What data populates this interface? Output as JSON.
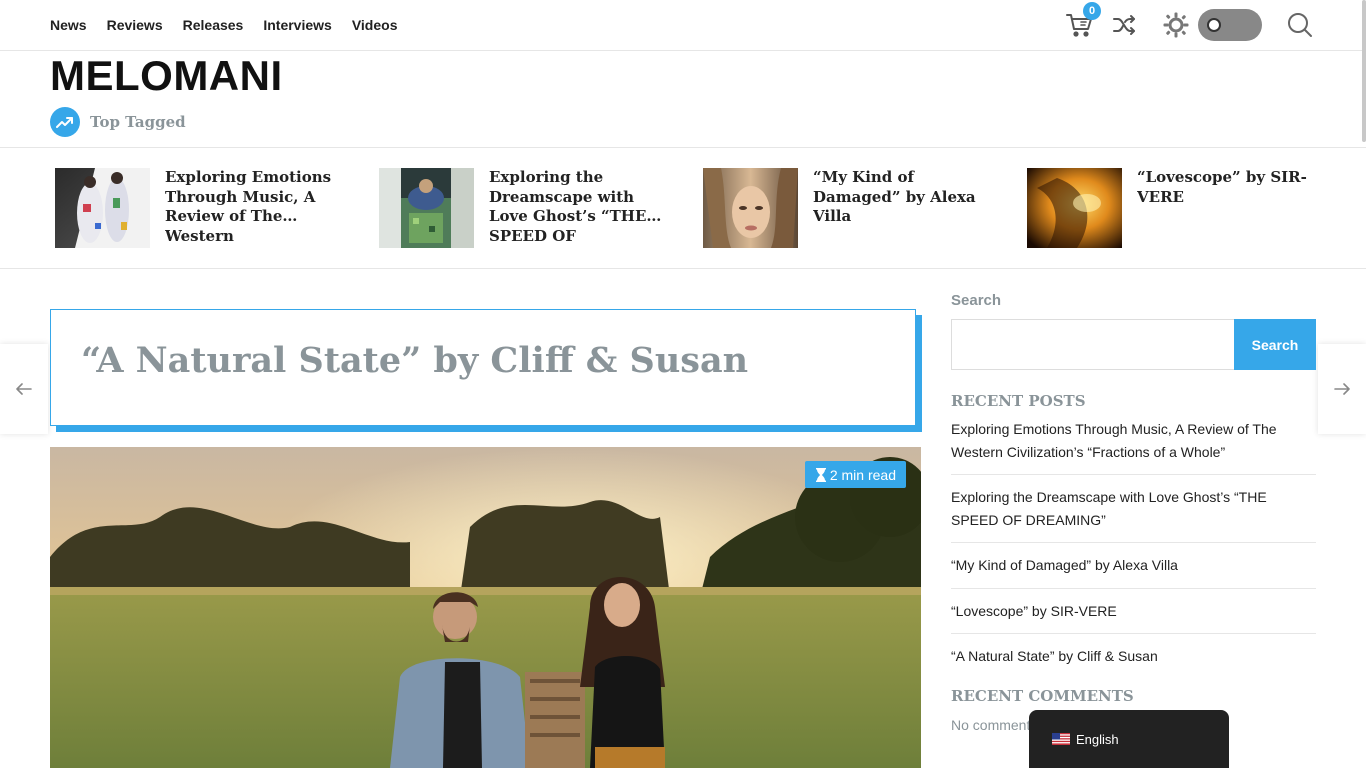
{
  "nav": {
    "items": [
      "News",
      "Reviews",
      "Releases",
      "Interviews",
      "Videos"
    ]
  },
  "header": {
    "cart_count": "0",
    "site_title": "MELOMANI",
    "top_tagged_label": "Top Tagged"
  },
  "ticker": [
    {
      "title": "Exploring Emotions Through Music, A Review of The Western Civilization’s “Fractions of a Whole”"
    },
    {
      "title": "Exploring the Dreamscape with Love Ghost’s “THE SPEED OF DREAMING”"
    },
    {
      "title": "“My Kind of Damaged” by Alexa Villa"
    },
    {
      "title": "“Lovescope” by SIR-VERE"
    }
  ],
  "article": {
    "title": "“A Natural State” by Cliff & Susan",
    "read_time": "2 min read"
  },
  "sidebar": {
    "search_label": "Search",
    "search_button": "Search",
    "search_value": "",
    "recent_posts_heading": "RECENT POSTS",
    "recent_posts": [
      "Exploring Emotions Through Music, A Review of The Western Civilization’s “Fractions of a Whole”",
      "Exploring the Dreamscape with Love Ghost’s “THE SPEED OF DREAMING”",
      "“My Kind of Damaged” by Alexa Villa",
      "“Lovescope” by SIR-VERE",
      "“A Natural State” by Cliff & Susan"
    ],
    "recent_comments_heading": "RECENT COMMENTS",
    "no_comments": "No comments to show."
  },
  "language": {
    "selected": "English"
  },
  "colors": {
    "accent": "#36a7e9",
    "muted_heading": "#8a9499",
    "text": "#222222"
  },
  "icons": [
    "cart-icon",
    "shuffle-icon",
    "sun-icon",
    "search-icon",
    "trending-icon",
    "hourglass-icon",
    "arrow-left-icon",
    "arrow-right-icon",
    "us-flag-icon"
  ]
}
